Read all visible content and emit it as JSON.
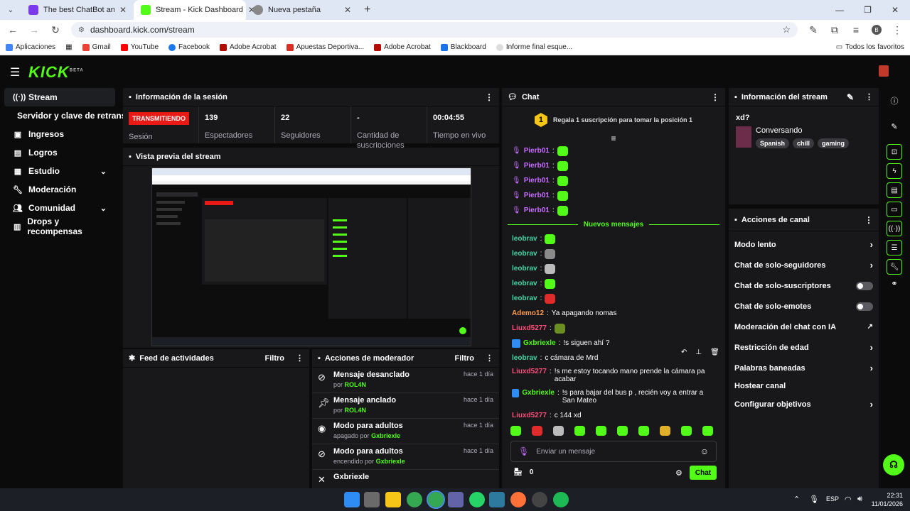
{
  "browser": {
    "tabs": [
      {
        "title": "The best ChatBot and Widgets",
        "favicon_color": "#7c3aed"
      },
      {
        "title": "Stream - Kick Dashboard",
        "favicon_color": "#53fc18"
      },
      {
        "title": "Nueva pestaña",
        "favicon_color": "#888888"
      }
    ],
    "url": "dashboard.kick.com/stream",
    "profile_initial": "B",
    "bookmarks": [
      "Aplicaciones",
      "Gmail",
      "YouTube",
      "Facebook",
      "Adobe Acrobat",
      "Apuestas Deportiva...",
      "Adobe Acrobat",
      "Blackboard",
      "Informe final esque..."
    ],
    "all_favorites": "Todos los favoritos"
  },
  "kick": {
    "logo": "KICK",
    "logo_sup": "BETA",
    "accent": "#53fc18",
    "sidebar": [
      {
        "label": "Stream",
        "icon": "broadcast-icon"
      },
      {
        "label": "Servidor y clave de retransm",
        "icon": ""
      },
      {
        "label": "Ingresos",
        "icon": "money-icon"
      },
      {
        "label": "Logros",
        "icon": "trophy-icon"
      },
      {
        "label": "Estudio",
        "icon": "studio-icon",
        "chevron": true
      },
      {
        "label": "Moderación",
        "icon": "wrench-icon"
      },
      {
        "label": "Comunidad",
        "icon": "people-icon",
        "chevron": true
      },
      {
        "label": "Drops y recompensas",
        "icon": "drops-icon"
      }
    ],
    "session": {
      "title": "Información de la sesión",
      "live_badge": "TRANSMITIENDO",
      "stats": [
        {
          "value": "",
          "label": "Sesión"
        },
        {
          "value": "139",
          "label": "Espectadores"
        },
        {
          "value": "22",
          "label": "Seguidores"
        },
        {
          "value": "-",
          "label": "Cantidad de suscripciones"
        },
        {
          "value": "00:04:55",
          "label": "Tiempo en vivo"
        }
      ]
    },
    "preview": {
      "title": "Vista previa del stream"
    },
    "activity": {
      "title": "Feed de actividades",
      "filter": "Filtro"
    },
    "mod_actions": {
      "title": "Acciones de moderador",
      "filter": "Filtro",
      "rows": [
        {
          "title": "Mensaje desanclado",
          "by": "por",
          "user": "ROL4N",
          "time": "hace 1 día",
          "icon": "unpin-icon"
        },
        {
          "title": "Mensaje anclado",
          "by": "por",
          "user": "ROL4N",
          "time": "hace 1 día",
          "icon": "pin-icon"
        },
        {
          "title": "Modo para adultos",
          "by": "apagado por",
          "user": "Gxbriexle",
          "time": "hace 1 día",
          "icon": "eye-icon"
        },
        {
          "title": "Modo para adultos",
          "by": "encendido por",
          "user": "Gxbriexle",
          "time": "hace 1 día",
          "icon": "eye-off-icon"
        },
        {
          "title": "Gxbriexle",
          "by": "",
          "user": "",
          "time": "",
          "icon": "ban-icon"
        }
      ]
    },
    "chat": {
      "title": "Chat",
      "gift_rank": "1",
      "gift_text": "Regala 1 suscripción para tomar la posición 1",
      "new_messages": "Nuevos mensajes",
      "messages": [
        {
          "user": "Pierb01",
          "color": "#c86cff",
          "text": "",
          "emote": "#53fc18"
        },
        {
          "user": "Pierb01",
          "color": "#c86cff",
          "text": "",
          "emote": "#53fc18"
        },
        {
          "user": "Pierb01",
          "color": "#c86cff",
          "text": "",
          "emote": "#53fc18"
        },
        {
          "user": "Pierb01",
          "color": "#c86cff",
          "text": "",
          "emote": "#53fc18"
        },
        {
          "user": "Pierb01",
          "color": "#c86cff",
          "text": "",
          "emote": "#53fc18"
        }
      ],
      "messages2": [
        {
          "user": "leobrav",
          "color": "#42d6a4",
          "text": "",
          "emote": "#53fc18"
        },
        {
          "user": "leobrav",
          "color": "#42d6a4",
          "text": "",
          "emote": "#8a8a8a"
        },
        {
          "user": "leobrav",
          "color": "#42d6a4",
          "text": "",
          "emote": "#bbbbbb"
        },
        {
          "user": "leobrav",
          "color": "#42d6a4",
          "text": "",
          "emote": "#53fc18"
        },
        {
          "user": "leobrav",
          "color": "#42d6a4",
          "text": "",
          "emote": "#e02b2b"
        },
        {
          "user": "Ademo12",
          "color": "#ff9b4d",
          "text": "Ya apagando nomas",
          "emote": ""
        },
        {
          "user": "Liuxd5277",
          "color": "#ff4d7a",
          "text": "",
          "emote": "#6b8e23"
        },
        {
          "user": "Gxbriexle",
          "color": "#53fc18",
          "text": "!s siguen ahí ?",
          "emote": ""
        },
        {
          "user": "leobrav",
          "color": "#42d6a4",
          "text": "c cámara de Mrd",
          "emote": ""
        },
        {
          "user": "Liuxd5277",
          "color": "#ff4d7a",
          "text": "!s me estoy tocando mano prende la cámara pa acabar",
          "emote": ""
        },
        {
          "user": "Gxbriexle",
          "color": "#53fc18",
          "text": "!s para bajar del bus p , recién voy a entrar a San Mateo",
          "emote": ""
        },
        {
          "user": "Liuxd5277",
          "color": "#ff4d7a",
          "text": "c 144 xd",
          "emote": ""
        }
      ],
      "emote_bar": [
        "#53fc18",
        "#e02b2b",
        "#bbbbbb",
        "#53fc18",
        "#53fc18",
        "#53fc18",
        "#53fc18",
        "#e0b02b",
        "#53fc18",
        "#53fc18"
      ],
      "placeholder": "Enviar un mensaje",
      "points": "0",
      "send": "Chat"
    },
    "stream_info": {
      "title": "Información del stream",
      "stream_title": "xd?",
      "category": "Conversando",
      "tags": [
        "Spanish",
        "chill",
        "gaming"
      ]
    },
    "channel_actions": {
      "title": "Acciones de canal",
      "items": [
        {
          "label": "Modo lento",
          "type": "chevron"
        },
        {
          "label": "Chat de solo-seguidores",
          "type": "chevron"
        },
        {
          "label": "Chat de solo-suscriptores",
          "type": "toggle"
        },
        {
          "label": "Chat de solo-emotes",
          "type": "toggle"
        },
        {
          "label": "Moderación del chat con IA",
          "type": "external"
        },
        {
          "label": "Restricción de edad",
          "type": "chevron"
        },
        {
          "label": "Palabras baneadas",
          "type": "chevron"
        },
        {
          "label": "Hostear canal",
          "type": "none"
        },
        {
          "label": "Configurar objetivos",
          "type": "chevron"
        }
      ]
    }
  },
  "taskbar": {
    "lang": "ESP",
    "time": "22:31",
    "date": "11/01/2026"
  }
}
